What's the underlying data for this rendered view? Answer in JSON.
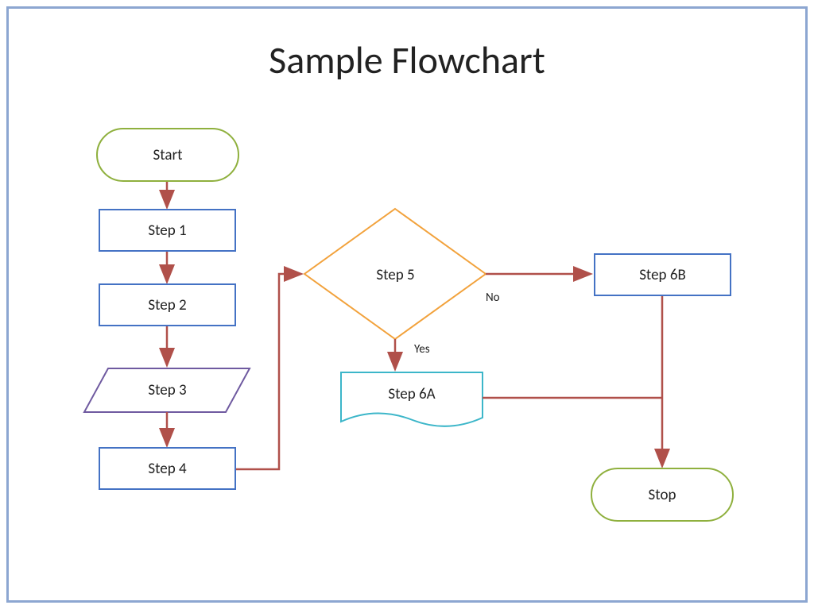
{
  "title": "Sample Flowchart",
  "nodes": {
    "start": "Start",
    "step1": "Step 1",
    "step2": "Step 2",
    "step3": "Step 3",
    "step4": "Step 4",
    "step5": "Step 5",
    "step6a": "Step 6A",
    "step6b": "Step 6B",
    "stop": "Stop"
  },
  "labels": {
    "yes": "Yes",
    "no": "No"
  },
  "colors": {
    "terminator": "#8FB03E",
    "process": "#4472C4",
    "data": "#6F5AA0",
    "decision": "#F2A23C",
    "document": "#3CB6C9",
    "arrow": "#B0504A"
  }
}
